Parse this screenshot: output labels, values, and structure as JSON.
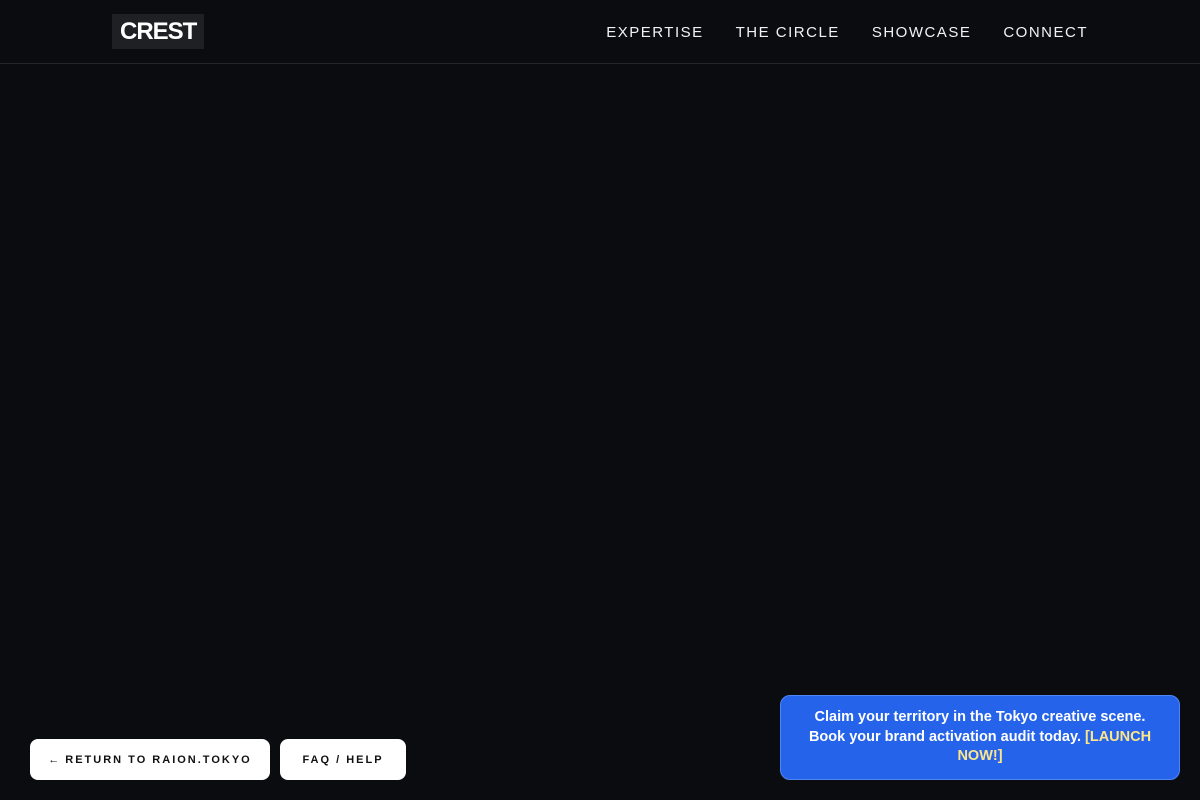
{
  "brand": {
    "logo_text": "CREST"
  },
  "nav": {
    "items": [
      {
        "label": "EXPERTISE"
      },
      {
        "label": "THE CIRCLE"
      },
      {
        "label": "SHOWCASE"
      },
      {
        "label": "CONNECT"
      }
    ]
  },
  "footer_buttons": {
    "return_arrow": "←",
    "return_label": "RETURN TO RAION.TOKYO",
    "faq_label": "FAQ / HELP"
  },
  "promo": {
    "line1": "Claim your territory in the Tokyo creative scene.",
    "line2": "Book your brand activation audit today.",
    "cta": "[LAUNCH NOW!]"
  },
  "colors": {
    "background": "#0b0c10",
    "promo_bg": "#2563eb",
    "promo_cta": "#fde68a",
    "button_bg": "#ffffff"
  }
}
